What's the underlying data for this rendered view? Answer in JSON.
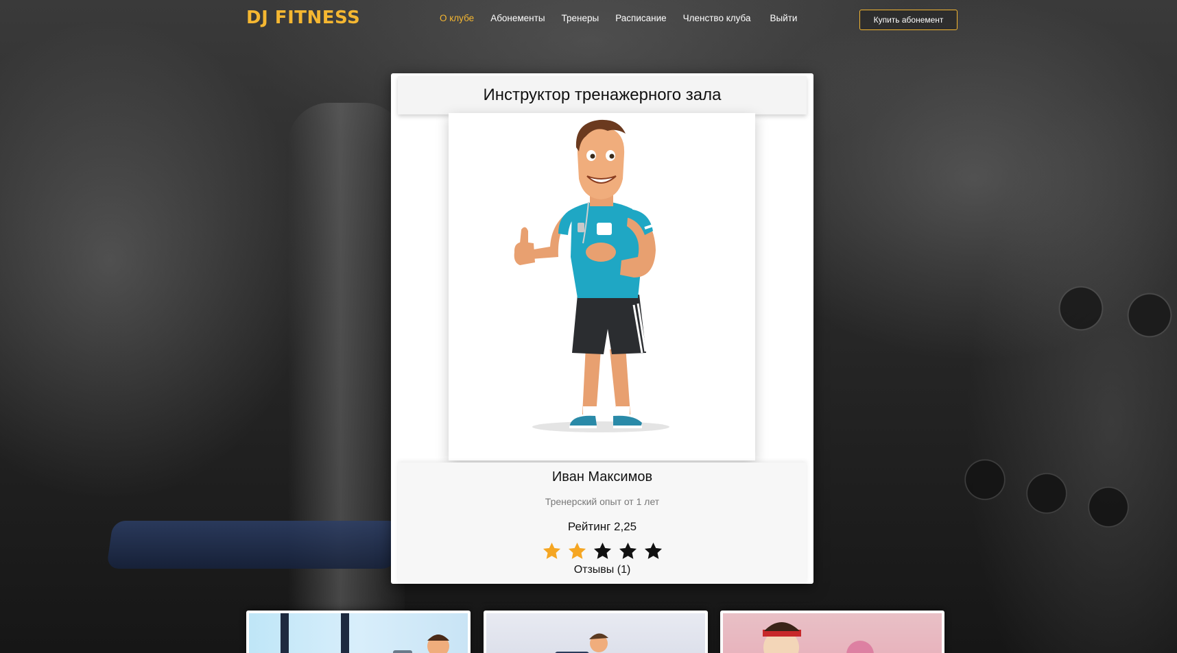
{
  "header": {
    "logo": "DJ FITNESS",
    "nav": [
      {
        "label": "О клубе",
        "active": true
      },
      {
        "label": "Абонементы",
        "active": false
      },
      {
        "label": "Тренеры",
        "active": false
      },
      {
        "label": "Расписание",
        "active": false
      },
      {
        "label": "Членство клуба",
        "active": false
      },
      {
        "label": "Выйти",
        "active": false
      }
    ],
    "buy_button": "Купить абонемент"
  },
  "trainer_card": {
    "title": "Инструктор тренажерного зала",
    "photo_alt": "trainer-illustration",
    "name": "Иван Максимов",
    "experience": "Тренерский опыт от 1 лет",
    "rating_text": "Рейтинг 2,25",
    "rating_value": 2.25,
    "rating_max": 5,
    "stars_filled": 2,
    "reviews": "Отзывы (1)"
  },
  "colors": {
    "accent": "#f5b731",
    "star_filled": "#f5a623",
    "star_empty": "#111111"
  },
  "related_trainers_count": 3
}
